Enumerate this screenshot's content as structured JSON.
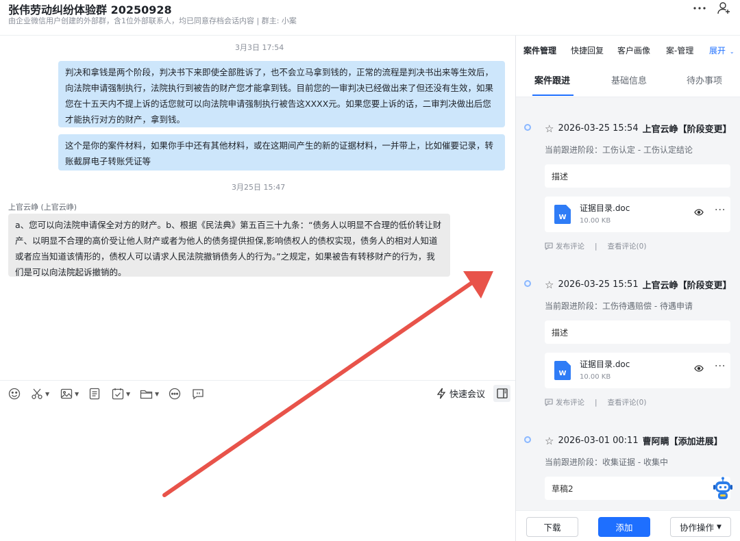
{
  "header": {
    "title": "张伟劳动纠纷体验群 20250928",
    "subtitle": "由企业微信用户创建的外部群，含1位外部联系人，均已同意存档会话内容 | 群主: 小案",
    "more_icon": "more-dots-icon",
    "add_member_icon": "add-person-icon"
  },
  "chat": {
    "messages": [
      {
        "time": "3月3日 17:54"
      },
      {
        "text": "判决和拿钱是两个阶段，判决书下来即使全部胜诉了，也不会立马拿到钱的，正常的流程是判决书出来等生效后，向法院申请强制执行，法院执行到被告的财产您才能拿到钱。目前您的一审判决已经做出来了但还没有生效，如果您在十五天内不提上诉的话您就可以向法院申请强制执行被告这XXXX元。如果您要上诉的话，二审判决做出后您才能执行对方的财产，拿到钱。"
      },
      {
        "text": "这个是你的案件材料，如果你手中还有其他材料，或在这期间产生的新的证据材料，一并带上，比如催要记录，转账截屏电子转账凭证等"
      },
      {
        "time": "3月25日 15:47"
      },
      {
        "sender": "上官云峥 (上官云峥)",
        "text": "a、您可以向法院申请保全对方的财产。b、根据《民法典》第五百三十九条：“债务人以明显不合理的低价转让财产、以明显不合理的高价受让他人财产或者为他人的债务提供担保,影响债权人的债权实现，债务人的相对人知道或者应当知道该情形的，债权人可以请求人民法院撤销债务人的行为。”之规定，如果被告有转移财产的行为，我们是可以向法院起诉撤销的。"
      }
    ]
  },
  "toolbar": {
    "quick_meeting": "快速会议"
  },
  "side": {
    "tabs": [
      "案件管理",
      "快捷回复",
      "客户画像",
      "案-管理",
      "展开"
    ],
    "sub_tabs": [
      "案件跟进",
      "基础信息",
      "待办事项"
    ],
    "entries": [
      {
        "datetime": "2026-03-25 15:54",
        "who": "上官云峥【阶段变更】",
        "stage": "当前跟进阶段：工伤认定 - 工伤认定结论",
        "desc": "描述",
        "file_name": "证据目录.doc",
        "file_size": "10.00 KB",
        "file_badge": "W",
        "comment": "发布评论",
        "view_comments": "查看评论(0)",
        "sep": "|"
      },
      {
        "datetime": "2026-03-25 15:51",
        "who": "上官云峥【阶段变更】",
        "stage": "当前跟进阶段：工伤待遇赔偿 - 待遇申请",
        "desc": "描述",
        "file_name": "证据目录.doc",
        "file_size": "10.00 KB",
        "file_badge": "W",
        "comment": "发布评论",
        "view_comments": "查看评论(0)",
        "sep": "|"
      },
      {
        "datetime": "2026-03-01 00:11",
        "who": "曹阿瞒【添加进展】",
        "stage": "当前跟进阶段：收集证据 - 收集中",
        "desc": "草稿2"
      }
    ],
    "footer": {
      "download": "下载",
      "add": "添加",
      "collab": "协作操作"
    }
  },
  "colors": {
    "accent": "#1e6fff",
    "bubble_out": "#cde6fb",
    "bubble_in": "#ebebeb",
    "annotation_arrow": "#e8534a"
  }
}
